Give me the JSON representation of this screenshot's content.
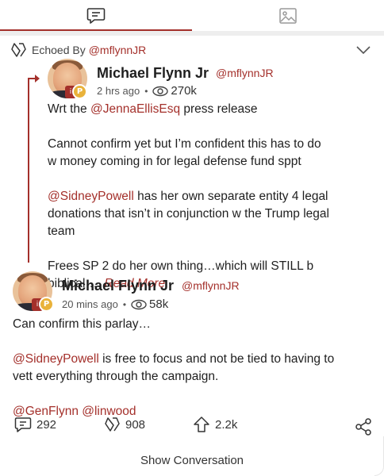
{
  "tabs": [
    {
      "icon": "post-icon",
      "active": true
    },
    {
      "icon": "image-icon",
      "active": false
    }
  ],
  "accent_color": "#a4302b",
  "echo": {
    "label": "Echoed By",
    "handle": "@mflynnJR"
  },
  "quoted_post": {
    "author_name": "Michael Flynn Jr",
    "author_handle": "@mflynnJR",
    "time": "2 hrs ago",
    "views": "270k",
    "lines": {
      "l1_prefix": "Wrt the ",
      "l1_mention": "@JennaEllisEsq",
      "l1_suffix": " press release",
      "l2": "Cannot confirm yet but I’m confident this has to do",
      "l3": "w money coming in for legal defense fund sppt",
      "l4_mention": "@SidneyPowell",
      "l4_suffix": " has her own separate entity 4 legal",
      "l5": "donations that isn’t in conjunction w the Trump legal",
      "l6": "team",
      "l7": "Frees SP 2 do her own thing…which will STILL b",
      "l8": "biblical…. ",
      "read_more": "Read More"
    }
  },
  "main_post": {
    "author_name": "Michael Flynn Jr",
    "author_handle": "@mflynnJR",
    "time": "20 mins ago",
    "views": "58k",
    "lines": {
      "l1": "Can confirm this parlay…",
      "l2_mention": "@SidneyPowell",
      "l2_suffix": " is free to focus and not be tied to having to",
      "l3": "vett everything through the campaign.",
      "tag1": "@GenFlynn",
      "tag2": "@linwood"
    }
  },
  "actions": {
    "comments": "292",
    "echoes": "908",
    "upvotes": "2.2k"
  },
  "show_conversation": "Show Conversation"
}
